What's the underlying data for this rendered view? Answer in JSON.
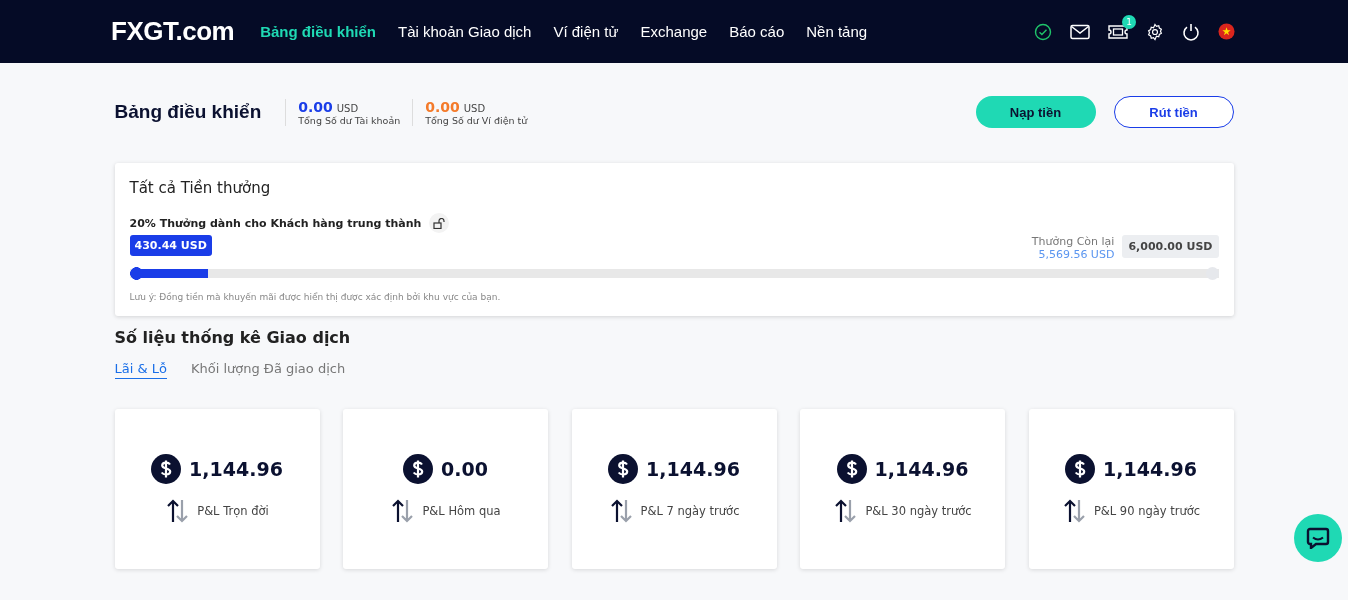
{
  "header": {
    "logo": "FXGT.com",
    "nav": [
      {
        "label": "Bảng điều khiển",
        "selected": true
      },
      {
        "label": "Tài khoản Giao dịch",
        "selected": false
      },
      {
        "label": "Ví điện tử",
        "selected": false
      },
      {
        "label": "Exchange",
        "selected": false
      },
      {
        "label": "Báo cáo",
        "selected": false
      },
      {
        "label": "Nền tảng",
        "selected": false
      }
    ],
    "notification_count": "1"
  },
  "summary": {
    "title": "Bảng điều khiển",
    "balances": [
      {
        "amount": "0.00",
        "currency": "USD",
        "label": "Tổng Số dư Tài khoản",
        "color": "#1a3de8"
      },
      {
        "amount": "0.00",
        "currency": "USD",
        "label": "Tổng Số dư Ví điện tử",
        "color": "#f47a2a"
      }
    ],
    "buttons": [
      {
        "label": "Nạp tiền",
        "kind": "primary"
      },
      {
        "label": "Rút tiền",
        "kind": "outline"
      }
    ]
  },
  "bonus": {
    "title": "Tất cả Tiền thưởng",
    "name": "20% Thưởng dành cho Khách hàng trung thành",
    "earned": "430.44 USD",
    "remaining_label": "Thưởng Còn lại",
    "remaining": "5,569.56 USD",
    "total": "6,000.00 USD",
    "level": 0.072,
    "note": "Lưu ý: Đồng tiền mà khuyến mãi được hiển thị được xác định bởi khu vực của bạn."
  },
  "stats": {
    "title": "Số liệu thống kê Giao dịch",
    "tabs": [
      {
        "label": "Lãi & Lỗ",
        "selected": true
      },
      {
        "label": "Khối lượng Đã giao dịch",
        "selected": false
      }
    ],
    "cards": [
      {
        "value": "1,144.96",
        "label": "P&L Trọn đời"
      },
      {
        "value": "0.00",
        "label": "P&L Hôm qua"
      },
      {
        "value": "1,144.96",
        "label": "P&L 7 ngày trước"
      },
      {
        "value": "1,144.96",
        "label": "P&L 30 ngày trước"
      },
      {
        "value": "1,144.96",
        "label": "P&L 90 ngày trước"
      }
    ]
  }
}
